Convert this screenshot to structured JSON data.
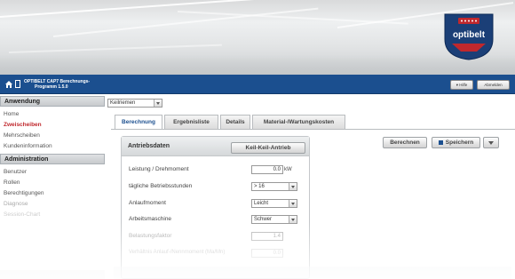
{
  "brand": {
    "logo_text": "optibelt",
    "blue": "#1b4f8f",
    "red": "#c0282d"
  },
  "topbar": {
    "title_line1": "OPTIBELT CAP7 Berechnungs-",
    "title_line2": "Programm 1.5.0",
    "help_label": "▾ Hilfe",
    "logout_label": "Abmelden"
  },
  "sidebar": {
    "section1": "Anwendung",
    "items1": [
      "Home",
      "Zweischeiben",
      "Mehrscheiben",
      "Kundeninformation"
    ],
    "section2": "Administration",
    "items2": [
      "Benutzer",
      "Rollen",
      "Berechtigungen",
      "Diagnose",
      "Session-Chart"
    ]
  },
  "main": {
    "product_select": "Keilriemen",
    "tabs": [
      "Berechnung",
      "Ergebnisliste",
      "Details",
      "Material-/Wartungskosten"
    ],
    "calculate_label": "Berechnen",
    "save_label": "Speichern",
    "panel": {
      "title": "Antriebsdaten",
      "type_button": "Keil-Keil-Antrieb",
      "rows": [
        {
          "label": "Leistung / Drehmoment",
          "value": "0.0",
          "unit": "kW"
        },
        {
          "label": "tägliche Betriebsstunden",
          "value": "> 16"
        },
        {
          "label": "Anlaufmoment",
          "value": "Leicht"
        },
        {
          "label": "Arbeitsmaschine",
          "value": "Schwer"
        },
        {
          "label": "Belastungsfaktor",
          "value": "1.4"
        },
        {
          "label": "Verhältnis Anlauf-/Nennmoment (Ma/Mn)",
          "value": "0.0"
        }
      ]
    }
  }
}
